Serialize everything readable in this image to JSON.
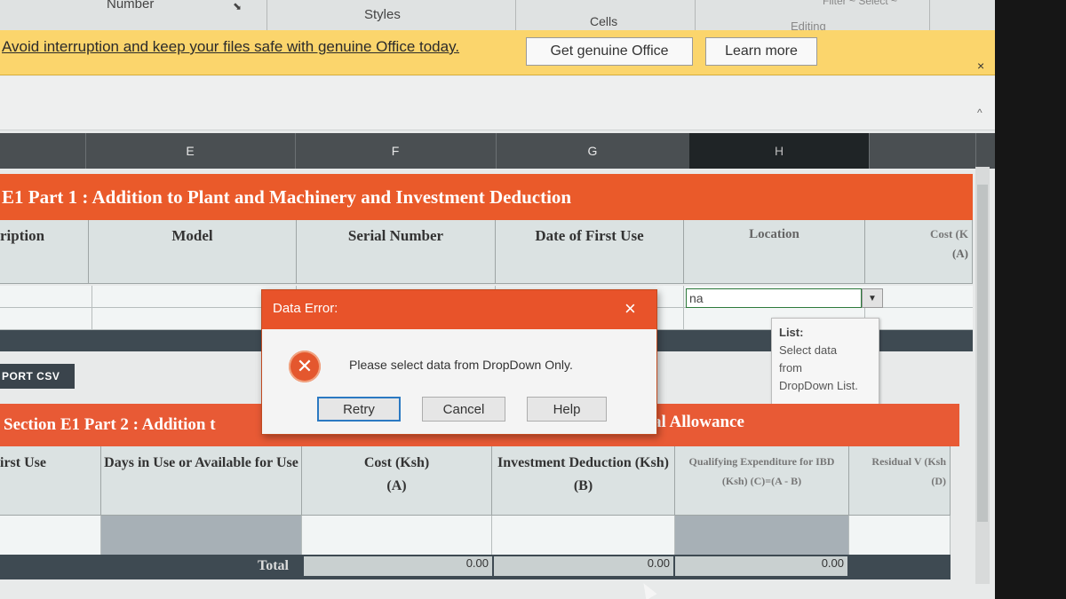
{
  "ribbon": {
    "groups": [
      "Number",
      "Styles",
      "Cells",
      "Editing"
    ],
    "filter_select": "Filter ~ Select ~"
  },
  "message_bar": {
    "text": "Avoid interruption and keep your files safe with genuine Office today.",
    "primary_button": "Get genuine Office",
    "secondary_button": "Learn more",
    "close": "×"
  },
  "column_headers": [
    "E",
    "F",
    "G",
    "H"
  ],
  "section1": {
    "title": "E1 Part 1 : Addition to Plant and Machinery and Investment Deduction",
    "headers": [
      {
        "label": "ription",
        "sub": ""
      },
      {
        "label": "Model",
        "sub": ""
      },
      {
        "label": "Serial Number",
        "sub": ""
      },
      {
        "label": "Date of First Use",
        "sub": ""
      },
      {
        "label": "Location",
        "sub": ""
      },
      {
        "label": "Cost (K",
        "sub": "(A)"
      }
    ]
  },
  "active_cell": {
    "value": "na"
  },
  "tooltip": {
    "title": "List:",
    "lines": [
      "Select data",
      "from",
      "DropDown List."
    ]
  },
  "export_button": "PORT CSV",
  "section2": {
    "title_left": "Section E1 Part 2 : Addition t",
    "title_right": "al Allowance",
    "headers": [
      {
        "label": "irst Use",
        "sub": ""
      },
      {
        "label": "Days in Use or Available for Use",
        "sub": ""
      },
      {
        "label": "Cost (Ksh)",
        "sub": "(A)"
      },
      {
        "label": "Investment Deduction (Ksh)",
        "sub": "(B)"
      },
      {
        "label": "Qualifying Expenditure for IBD (Ksh) (C)=(A - B)",
        "sub": ""
      },
      {
        "label": "Residual V (Ksh",
        "sub": "(D)"
      }
    ],
    "total_label": "Total",
    "totals": [
      "0.00",
      "0.00",
      "0.00"
    ]
  },
  "dialog": {
    "title": "Data Error:",
    "message": "Please select data from DropDown Only.",
    "buttons": {
      "retry": "Retry",
      "cancel": "Cancel",
      "help": "Help"
    },
    "close": "×"
  }
}
